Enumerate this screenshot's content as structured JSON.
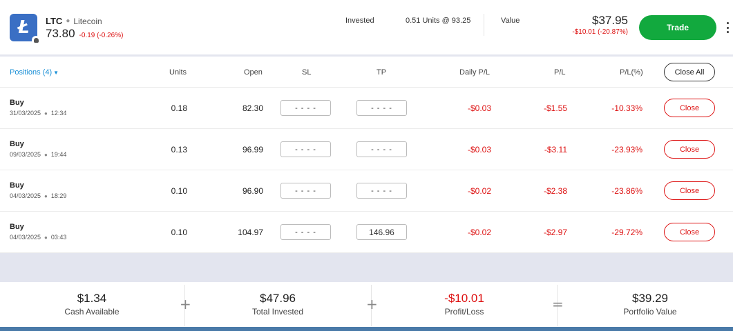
{
  "instrument": {
    "symbol": "LTC",
    "name": "Litecoin",
    "price": "73.80",
    "change": "-0.19 (-0.26%)",
    "logo_icon": "litecoin-logo"
  },
  "summary": {
    "invested_label": "Invested",
    "invested_value": "0.51 Units @ 93.25",
    "value_label": "Value",
    "value_amount": "$37.95",
    "value_change": "-$10.01 (-20.87%)",
    "trade_label": "Trade"
  },
  "table": {
    "positions_label": "Positions (4)",
    "columns": {
      "units": "Units",
      "open": "Open",
      "sl": "SL",
      "tp": "TP",
      "daily_pl": "Daily P/L",
      "pl": "P/L",
      "pl_pct": "P/L(%)"
    },
    "close_all_label": "Close All",
    "rows": [
      {
        "direction": "Buy",
        "date": "31/03/2025",
        "time": "12:34",
        "units": "0.18",
        "open": "82.30",
        "sl": "- - - -",
        "tp": "- - - -",
        "daily_pl": "-$0.03",
        "pl": "-$1.55",
        "pl_pct": "-10.33%",
        "close_label": "Close"
      },
      {
        "direction": "Buy",
        "date": "09/03/2025",
        "time": "19:44",
        "units": "0.13",
        "open": "96.99",
        "sl": "- - - -",
        "tp": "- - - -",
        "daily_pl": "-$0.03",
        "pl": "-$3.11",
        "pl_pct": "-23.93%",
        "close_label": "Close"
      },
      {
        "direction": "Buy",
        "date": "04/03/2025",
        "time": "18:29",
        "units": "0.10",
        "open": "96.90",
        "sl": "- - - -",
        "tp": "- - - -",
        "daily_pl": "-$0.02",
        "pl": "-$2.38",
        "pl_pct": "-23.86%",
        "close_label": "Close"
      },
      {
        "direction": "Buy",
        "date": "04/03/2025",
        "time": "03:43",
        "units": "0.10",
        "open": "104.97",
        "sl": "- - - -",
        "tp": "146.96",
        "daily_pl": "-$0.02",
        "pl": "-$2.97",
        "pl_pct": "-29.72%",
        "close_label": "Close"
      }
    ]
  },
  "footer": {
    "cash_available": {
      "amount": "$1.34",
      "label": "Cash Available"
    },
    "total_invested": {
      "amount": "$47.96",
      "label": "Total Invested"
    },
    "profit_loss": {
      "amount": "-$10.01",
      "label": "Profit/Loss"
    },
    "portfolio_value": {
      "amount": "$39.29",
      "label": "Portfolio Value"
    },
    "ops": [
      "+",
      "+",
      "="
    ]
  },
  "colors": {
    "trade_green": "#12a93e",
    "loss_red": "#dd1111",
    "link_blue": "#1a8fd6",
    "logo_blue": "#3a6fc4"
  }
}
